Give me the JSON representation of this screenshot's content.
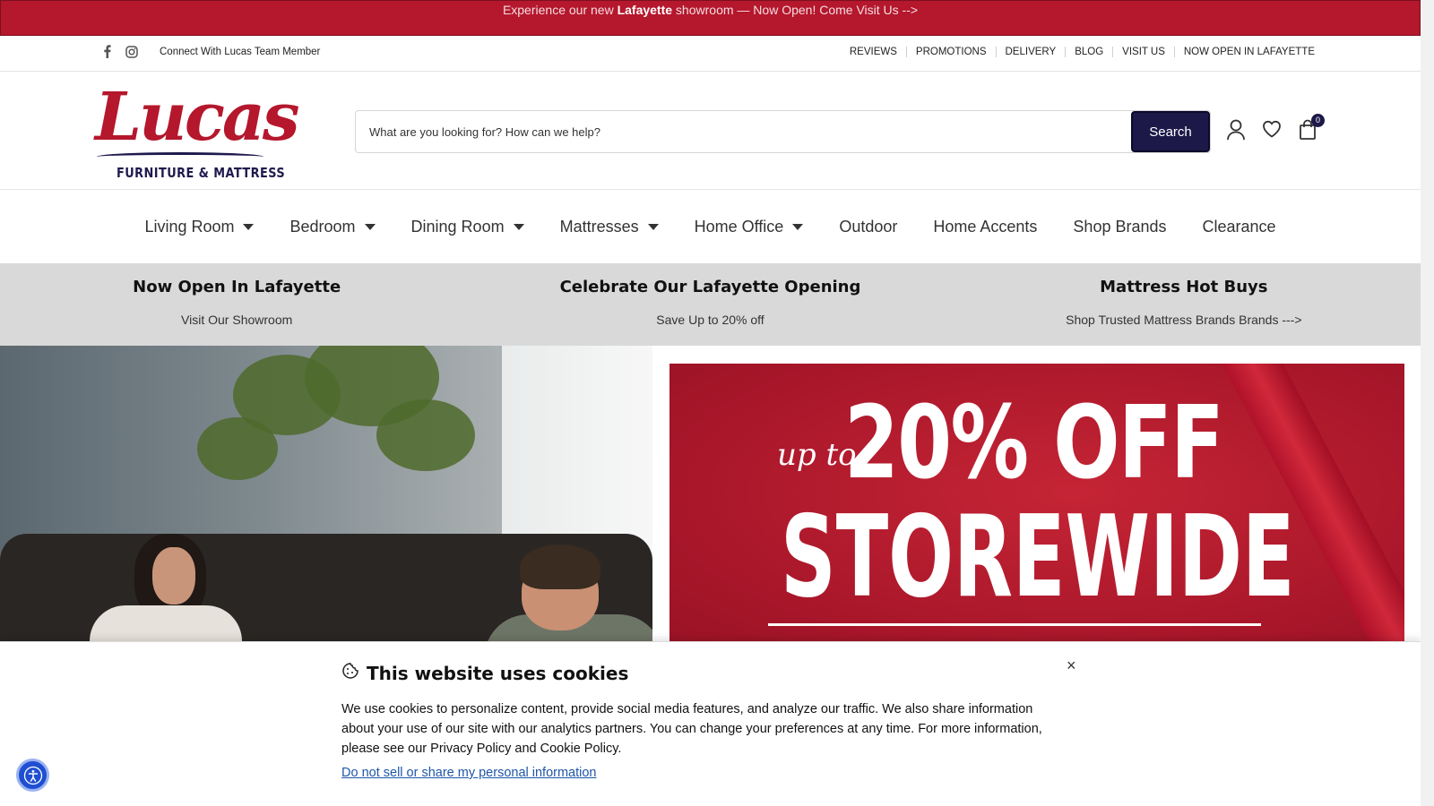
{
  "announcement": {
    "pre": "Experience our new ",
    "bold": "Lafayette",
    "post": " showroom — Now Open! Come Visit Us -->"
  },
  "utility": {
    "social_icons": [
      "facebook-icon",
      "instagram-icon"
    ],
    "connect_text": "Connect With Lucas Team Member",
    "links": [
      "REVIEWS",
      "PROMOTIONS",
      "DELIVERY",
      "BLOG",
      "VISIT US",
      "NOW OPEN IN LAFAYETTE"
    ]
  },
  "header": {
    "logo_script": "Lucas",
    "logo_sub": "FURNITURE & MATTRESS",
    "search_placeholder": "What are you looking for? How can we help?",
    "search_button": "Search",
    "icons": [
      "account-icon",
      "wishlist-heart-icon",
      "cart-bag-icon"
    ],
    "cart_count": "0"
  },
  "nav": {
    "items": [
      {
        "label": "Living Room",
        "dropdown": true
      },
      {
        "label": "Bedroom",
        "dropdown": true
      },
      {
        "label": "Dining Room",
        "dropdown": true
      },
      {
        "label": "Mattresses",
        "dropdown": true
      },
      {
        "label": "Home Office",
        "dropdown": true
      },
      {
        "label": "Outdoor",
        "dropdown": false
      },
      {
        "label": "Home Accents",
        "dropdown": false
      },
      {
        "label": "Shop Brands",
        "dropdown": false
      },
      {
        "label": "Clearance",
        "dropdown": false
      }
    ]
  },
  "promos": [
    {
      "title": "Now Open In Lafayette",
      "subtitle": "Visit Our Showroom"
    },
    {
      "title": "Celebrate Our Lafayette Opening",
      "subtitle": "Save Up to 20% off"
    },
    {
      "title": "Mattress Hot Buys",
      "subtitle": "Shop Trusted Mattress Brands Brands --->"
    }
  ],
  "hero": {
    "sale_upto": "up to",
    "sale_pct": "20% OFF",
    "sale_storewide": "STOREWIDE"
  },
  "cookie": {
    "title": "This website uses cookies",
    "text": "We use cookies to personalize content, provide social media features, and analyze our traffic. We also share information about your use of our site with our analytics partners. You can change your preferences at any time. For more information, please see our Privacy Policy and Cookie Policy.",
    "link": "Do not sell or share my personal information",
    "close": "×"
  },
  "colors": {
    "brand_red": "#b5172d",
    "brand_navy": "#1c1848",
    "promo_bg": "#d9d9d9",
    "link_blue": "#1e56a8",
    "a11y_blue": "#1f4fd1"
  }
}
